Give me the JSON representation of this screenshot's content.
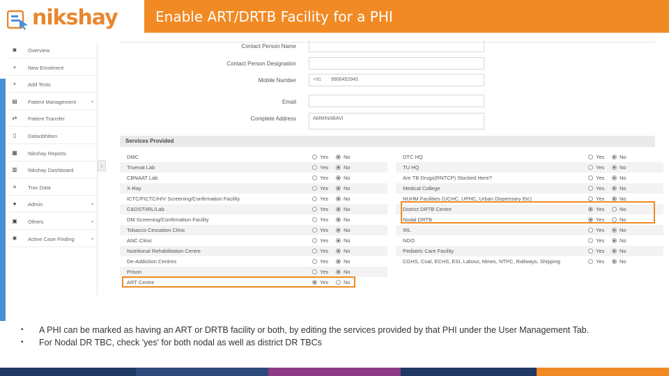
{
  "header": {
    "logo_text": "nikshay",
    "title": "Enable ART/DRTB Facility for a PHI"
  },
  "sidebar": {
    "items": [
      {
        "label": "Overview",
        "icon": "dashboard-icon",
        "chevron": false
      },
      {
        "label": "New Enrolment",
        "icon": "plus-icon",
        "chevron": false
      },
      {
        "label": "Add Tests",
        "icon": "plus-icon",
        "chevron": false
      },
      {
        "label": "Patient Management",
        "icon": "clipboard-icon",
        "chevron": true
      },
      {
        "label": "Patient Transfer",
        "icon": "transfer-icon",
        "chevron": false
      },
      {
        "label": "Dataobhition",
        "icon": "document-icon",
        "chevron": false
      },
      {
        "label": "Nikshay Reports",
        "icon": "report-icon",
        "chevron": false
      },
      {
        "label": "Nikshay Dashboard",
        "icon": "chart-icon",
        "chevron": false
      },
      {
        "label": "Trav Data",
        "icon": "list-icon",
        "chevron": false
      },
      {
        "label": "Admin",
        "icon": "user-icon",
        "chevron": true
      },
      {
        "label": "Others",
        "icon": "grid-icon",
        "chevron": true
      },
      {
        "label": "Active Case Finding",
        "icon": "search-icon",
        "chevron": true
      }
    ]
  },
  "form": {
    "contact_name_label": "Contact Person Name",
    "contact_designation_label": "Contact Person Designation",
    "mobile_label": "Mobile Number",
    "mobile_prefix": "+91",
    "mobile_value": "9906452945",
    "email_label": "Email",
    "address_label": "Complete Address",
    "address_value": "AMMINABAVI"
  },
  "services": {
    "title": "Services Provided",
    "yes_label": "Yes",
    "no_label": "No",
    "left": [
      {
        "name": "DMC",
        "value": "No"
      },
      {
        "name": "Truenat Lab",
        "value": "No"
      },
      {
        "name": "CBNAAT Lab",
        "value": "No"
      },
      {
        "name": "X-Ray",
        "value": "No"
      },
      {
        "name": "ICTC/FICTC/HIV Screening/Confirmation Facility",
        "value": "No"
      },
      {
        "name": "C&DST/IRL/Lab",
        "value": "No"
      },
      {
        "name": "DM Screening/Confirmation Facility",
        "value": "No"
      },
      {
        "name": "Tobacco Cessation Clinic",
        "value": "No"
      },
      {
        "name": "ANC Clinic",
        "value": "No"
      },
      {
        "name": "Nutritional Rehabilitation Centre",
        "value": "No"
      },
      {
        "name": "De-Addiction Centres",
        "value": "No"
      },
      {
        "name": "Prison",
        "value": "No"
      },
      {
        "name": "ART Centre",
        "value": "Yes"
      }
    ],
    "right": [
      {
        "name": "DTC HQ",
        "value": "No"
      },
      {
        "name": "TU HQ",
        "value": "No"
      },
      {
        "name": "Are TB Drugs(RNTCP) Stocked Here?",
        "value": "No"
      },
      {
        "name": "Medical College",
        "value": "No"
      },
      {
        "name": "NUHM Facilities (UCHC, UPHC, Urban Dispensary Etc)",
        "value": "No"
      },
      {
        "name": "District DRTB Centre",
        "value": "Yes"
      },
      {
        "name": "Nodal DRTB",
        "value": "Yes"
      },
      {
        "name": "IRL",
        "value": "No"
      },
      {
        "name": "NGO",
        "value": "No"
      },
      {
        "name": "Pediatric Care Facility",
        "value": "No"
      },
      {
        "name": "CGHS, Coal, ECHS, ESI, Labour, Mines, NTPC, Railways, Shipping",
        "value": "No"
      }
    ]
  },
  "bullets": [
    "A PHI can be marked as having an ART or DRTB facility or both, by editing the services provided by that PHI under the User Management Tab.",
    "For Nodal DR TBC, check 'yes' for both nodal as well as district DR TBCs"
  ],
  "colors": {
    "accent": "#f18a24",
    "footer": [
      "#1f3864",
      "#2e4a7d",
      "#8e3a84",
      "#1f3864",
      "#f18a24",
      "#1f3864"
    ]
  }
}
